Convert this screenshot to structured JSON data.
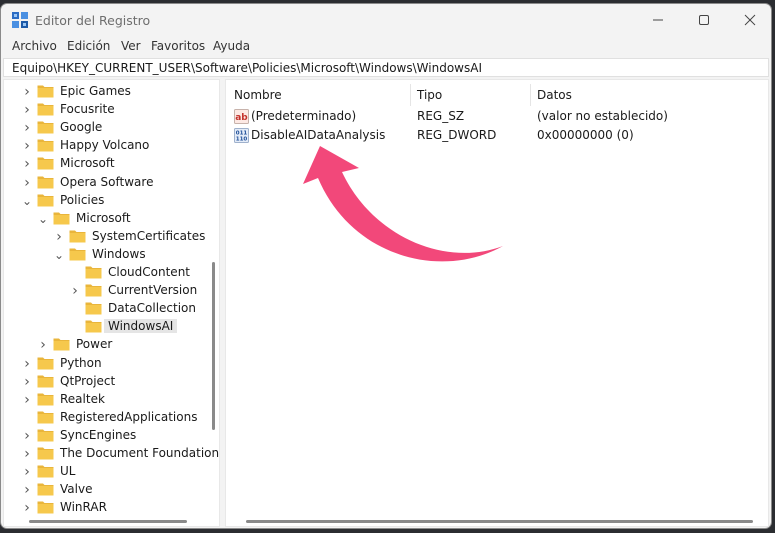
{
  "window": {
    "title": "Editor del Registro",
    "controls": [
      "minimize",
      "maximize",
      "close"
    ]
  },
  "menu": [
    "Archivo",
    "Edición",
    "Ver",
    "Favoritos",
    "Ayuda"
  ],
  "address": "Equipo\\HKEY_CURRENT_USER\\Software\\Policies\\Microsoft\\Windows\\WindowsAI",
  "tree": [
    {
      "label": "Epic Games",
      "level": 0,
      "chevron": "right"
    },
    {
      "label": "Focusrite",
      "level": 0,
      "chevron": "right"
    },
    {
      "label": "Google",
      "level": 0,
      "chevron": "right"
    },
    {
      "label": "Happy Volcano",
      "level": 0,
      "chevron": "right"
    },
    {
      "label": "Microsoft",
      "level": 0,
      "chevron": "right"
    },
    {
      "label": "Opera Software",
      "level": 0,
      "chevron": "right"
    },
    {
      "label": "Policies",
      "level": 0,
      "chevron": "down"
    },
    {
      "label": "Microsoft",
      "level": 1,
      "chevron": "down"
    },
    {
      "label": "SystemCertificates",
      "level": 2,
      "chevron": "right"
    },
    {
      "label": "Windows",
      "level": 2,
      "chevron": "down"
    },
    {
      "label": "CloudContent",
      "level": 3,
      "chevron": "none"
    },
    {
      "label": "CurrentVersion",
      "level": 3,
      "chevron": "right"
    },
    {
      "label": "DataCollection",
      "level": 3,
      "chevron": "none"
    },
    {
      "label": "WindowsAI",
      "level": 3,
      "chevron": "none",
      "selected": true
    },
    {
      "label": "Power",
      "level": 1,
      "chevron": "right"
    },
    {
      "label": "Python",
      "level": 0,
      "chevron": "right"
    },
    {
      "label": "QtProject",
      "level": 0,
      "chevron": "right"
    },
    {
      "label": "Realtek",
      "level": 0,
      "chevron": "right"
    },
    {
      "label": "RegisteredApplications",
      "level": 0,
      "chevron": "none"
    },
    {
      "label": "SyncEngines",
      "level": 0,
      "chevron": "right"
    },
    {
      "label": "The Document Foundation",
      "level": 0,
      "chevron": "right"
    },
    {
      "label": "UL",
      "level": 0,
      "chevron": "right"
    },
    {
      "label": "Valve",
      "level": 0,
      "chevron": "right"
    },
    {
      "label": "WinRAR",
      "level": 0,
      "chevron": "right"
    }
  ],
  "list": {
    "headers": [
      "Nombre",
      "Tipo",
      "Datos"
    ],
    "rows": [
      {
        "icon": "string-value-icon",
        "name": "(Predeterminado)",
        "type": "REG_SZ",
        "data": "(valor no establecido)"
      },
      {
        "icon": "binary-value-icon",
        "name": "DisableAIDataAnalysis",
        "type": "REG_DWORD",
        "data": "0x00000000 (0)"
      }
    ]
  },
  "colors": {
    "arrow": "#f2487a",
    "folder": "#f6c84c",
    "window_bg": "#f3f3f3",
    "selection": "#e5e5e5"
  }
}
